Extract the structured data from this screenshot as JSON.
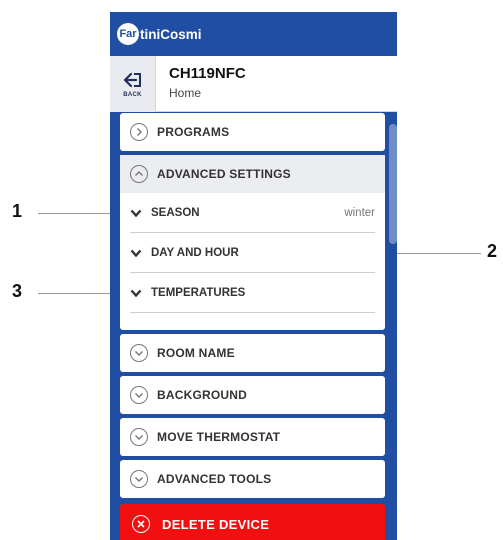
{
  "header": {
    "logo_initial": "Far",
    "logo_rest": "tiniCosmi"
  },
  "device": {
    "name": "CH119NFC",
    "location": "Home",
    "back_label": "BACK"
  },
  "menu": {
    "programs": "PROGRAMS",
    "advanced_settings": "ADVANCED SETTINGS",
    "sub_items": {
      "season": {
        "label": "SEASON",
        "value": "winter"
      },
      "day_hour": {
        "label": "DAY AND HOUR"
      },
      "temperatures": {
        "label": "TEMPERATURES"
      }
    },
    "room_name": "ROOM NAME",
    "background": "BACKGROUND",
    "move_thermostat": "MOVE THERMOSTAT",
    "advanced_tools": "ADVANCED TOOLS",
    "delete_device": "DELETE DEVICE"
  },
  "callouts": {
    "c1": "1",
    "c2": "2",
    "c3": "3"
  },
  "colors": {
    "brand_blue": "#1f4ea3",
    "delete_red": "#f20f0f",
    "panel_grey": "#ebedf0"
  }
}
